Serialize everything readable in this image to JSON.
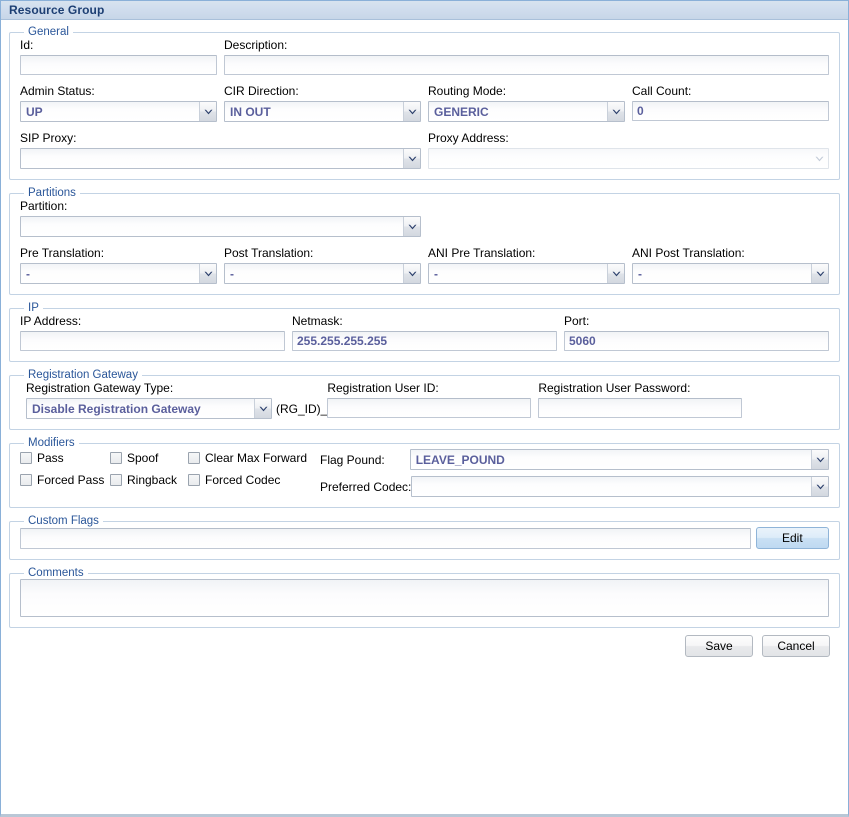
{
  "window": {
    "title": "Resource Group"
  },
  "general": {
    "legend": "General",
    "id_label": "Id:",
    "id_value": "",
    "description_label": "Description:",
    "description_value": "",
    "admin_status_label": "Admin Status:",
    "admin_status_value": "UP",
    "cir_direction_label": "CIR Direction:",
    "cir_direction_value": "IN OUT",
    "routing_mode_label": "Routing Mode:",
    "routing_mode_value": "GENERIC",
    "call_count_label": "Call Count:",
    "call_count_value": "0",
    "sip_proxy_label": "SIP Proxy:",
    "sip_proxy_value": "",
    "proxy_address_label": "Proxy Address:",
    "proxy_address_value": ""
  },
  "partitions": {
    "legend": "Partitions",
    "partition_label": "Partition:",
    "partition_value": "",
    "pre_translation_label": "Pre Translation:",
    "pre_translation_value": "-",
    "post_translation_label": "Post Translation:",
    "post_translation_value": "-",
    "ani_pre_translation_label": "ANI Pre Translation:",
    "ani_pre_translation_value": "-",
    "ani_post_translation_label": "ANI Post Translation:",
    "ani_post_translation_value": "-"
  },
  "ip": {
    "legend": "IP",
    "ip_address_label": "IP Address:",
    "ip_address_value": "",
    "netmask_label": "Netmask:",
    "netmask_value": "255.255.255.255",
    "port_label": "Port:",
    "port_value": "5060"
  },
  "registration_gateway": {
    "legend": "Registration Gateway",
    "type_label": "Registration Gateway Type:",
    "type_value": "Disable Registration Gateway",
    "user_id_label": "Registration User ID:",
    "user_id_prefix": "(RG_ID)_",
    "user_id_value": "",
    "password_label": "Registration User Password:",
    "password_value": ""
  },
  "modifiers": {
    "legend": "Modifiers",
    "checkboxes": [
      {
        "label": "Pass",
        "checked": false
      },
      {
        "label": "Spoof",
        "checked": false
      },
      {
        "label": "Clear Max Forward",
        "checked": false
      },
      {
        "label": "Forced Pass",
        "checked": false
      },
      {
        "label": "Ringback",
        "checked": false
      },
      {
        "label": "Forced Codec",
        "checked": false
      }
    ],
    "flag_pound_label": "Flag Pound:",
    "flag_pound_value": "LEAVE_POUND",
    "preferred_codec_label": "Preferred Codec:",
    "preferred_codec_value": ""
  },
  "custom_flags": {
    "legend": "Custom Flags",
    "value": "",
    "edit_label": "Edit"
  },
  "comments": {
    "legend": "Comments",
    "value": ""
  },
  "footer": {
    "save_label": "Save",
    "cancel_label": "Cancel"
  },
  "colors": {
    "title_text": "#1d3f73",
    "legend_text": "#2a5699",
    "value_text": "#5a5f9c",
    "titlebar_bg": "#cfdced",
    "group_border": "#c3d3e4",
    "primary_button": "#c9e0f4"
  }
}
